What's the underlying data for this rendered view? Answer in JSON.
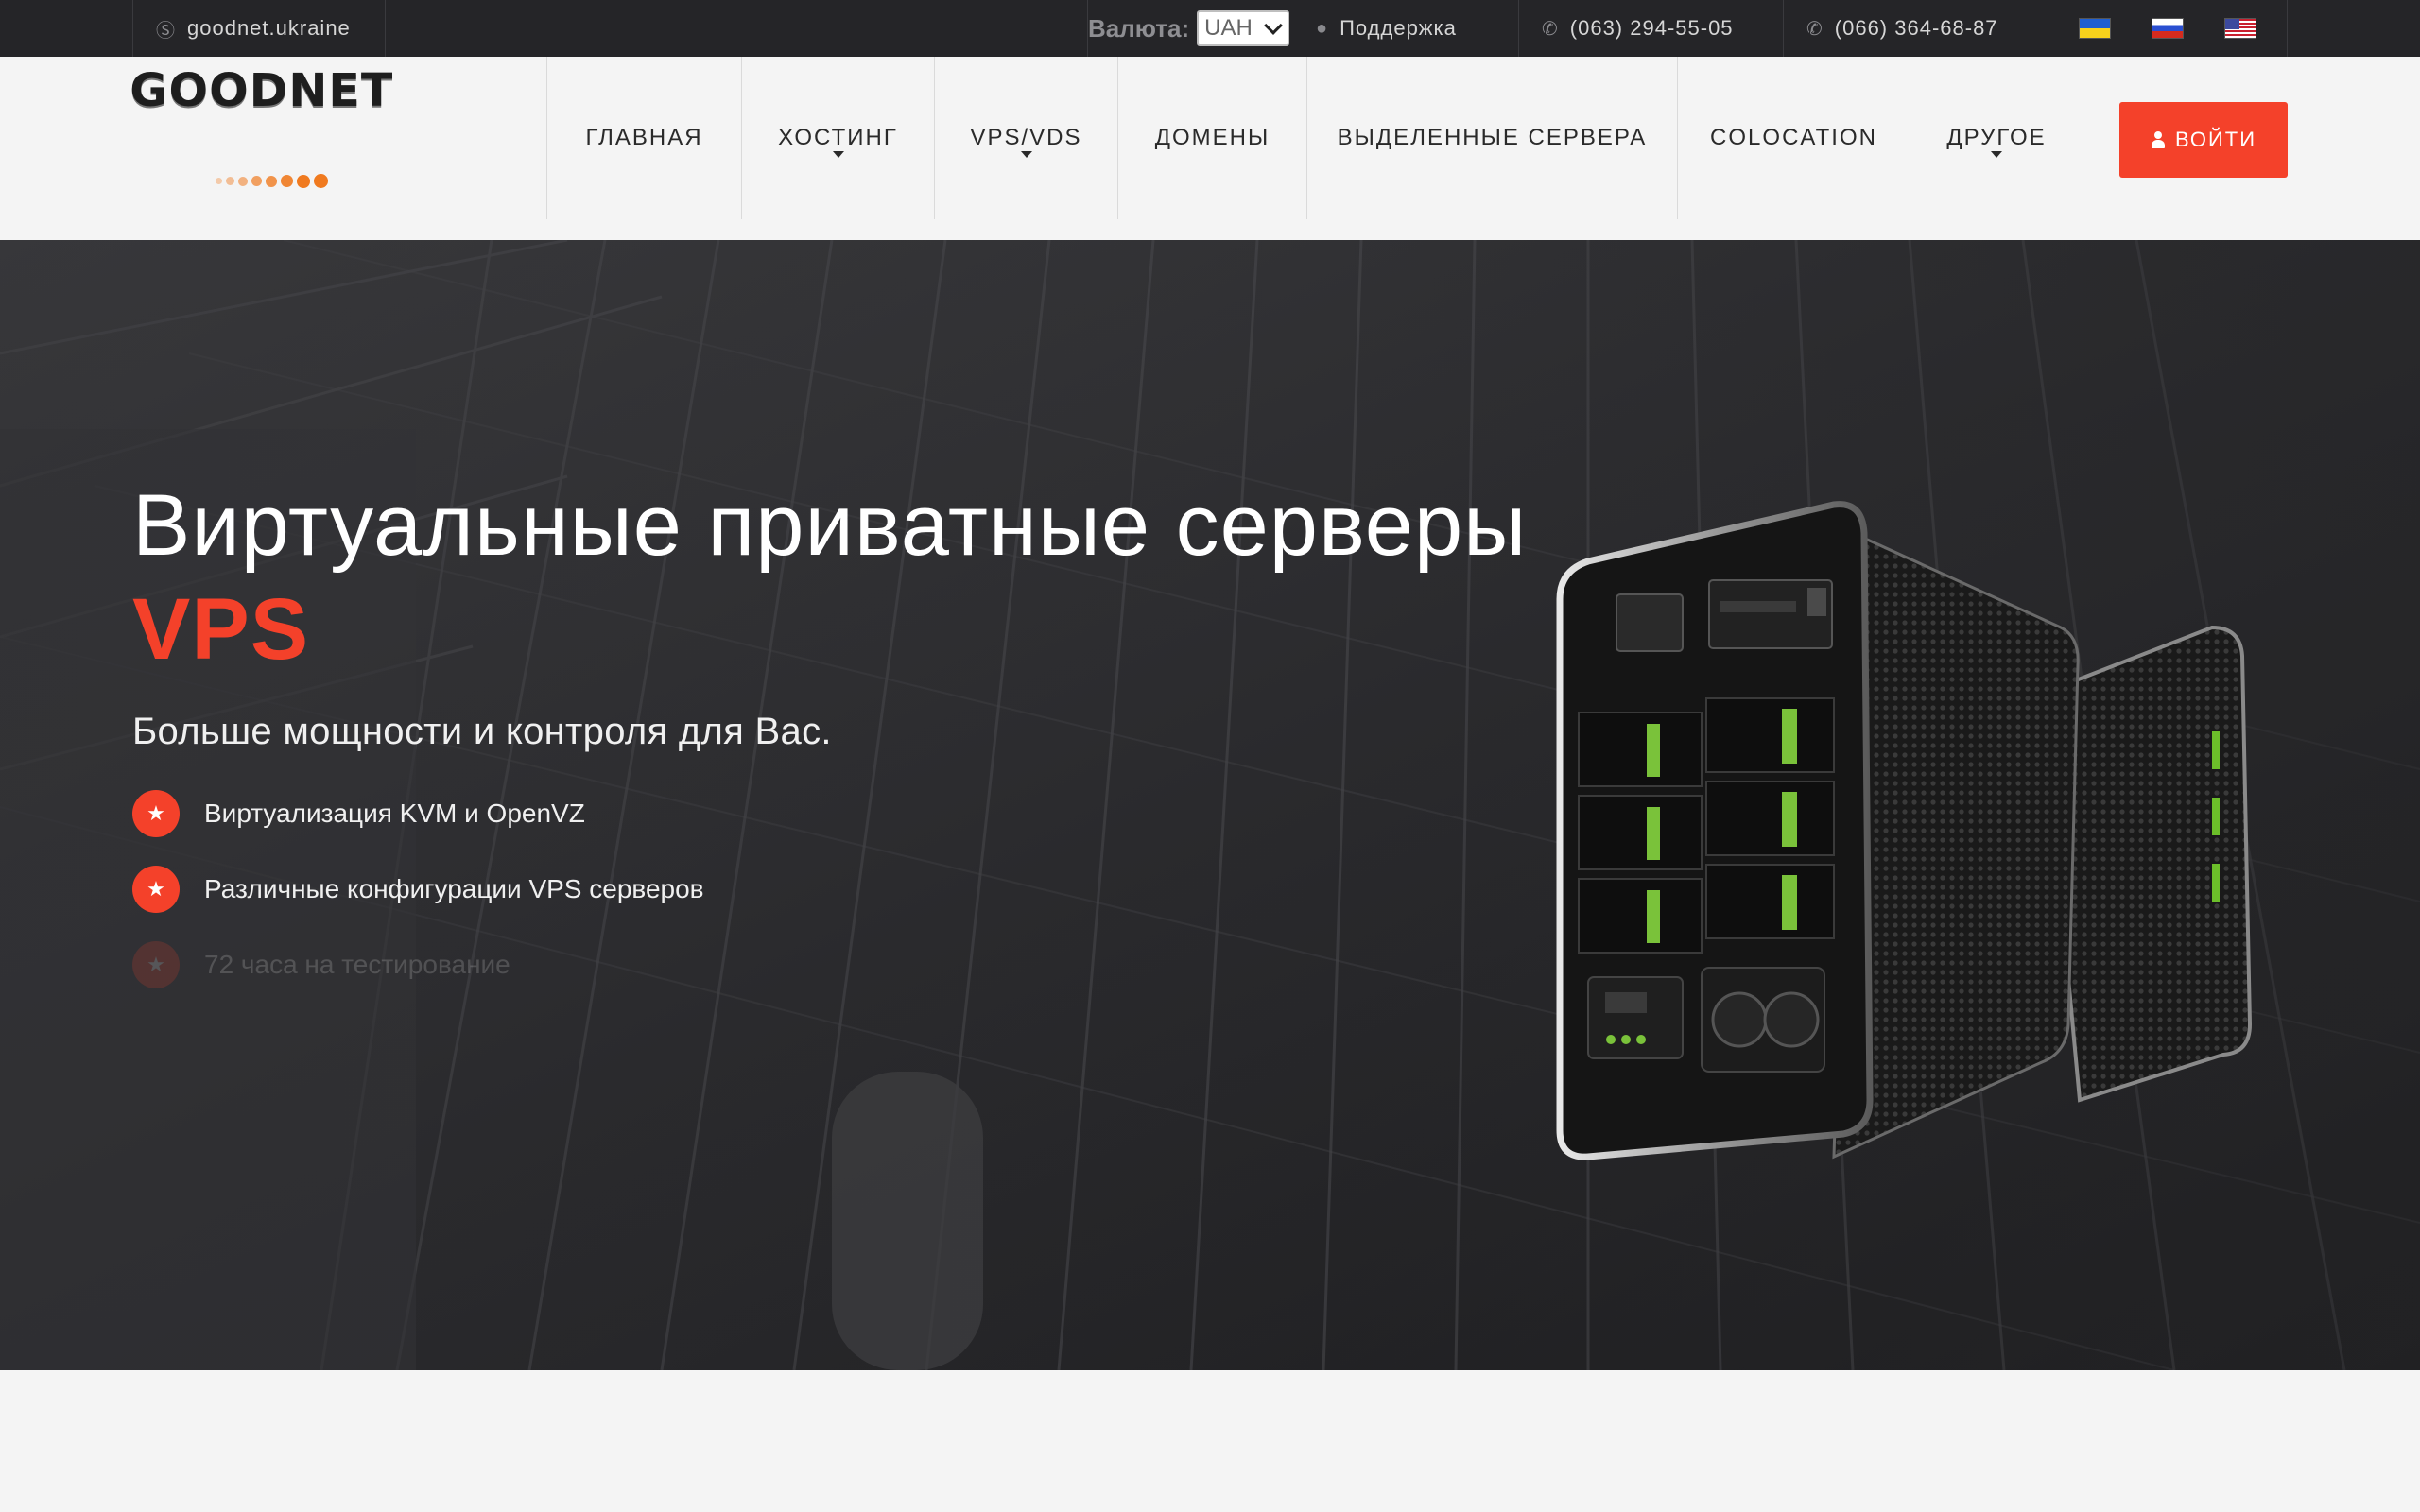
{
  "topbar": {
    "skype": "goodnet.ukraine",
    "currency_label": "Валюта:",
    "currency_value": "UAH",
    "support": "Поддержка",
    "phone1": "(063) 294-55-05",
    "phone2": "(066) 364-68-87",
    "flags": [
      "ukraine-flag",
      "russia-flag",
      "usa-flag"
    ]
  },
  "logo": {
    "text": "GOODNET"
  },
  "nav": {
    "items": [
      {
        "label": "ГЛАВНАЯ"
      },
      {
        "label": "ХОСТИНГ"
      },
      {
        "label": "VPS/VDS"
      },
      {
        "label": "ДОМЕНЫ"
      },
      {
        "label": "ВЫДЕЛЕННЫЕ СЕРВЕРА"
      },
      {
        "label": "COLOCATION"
      },
      {
        "label": "ДРУГОЕ"
      }
    ],
    "login": "ВОЙТИ"
  },
  "hero": {
    "title": "Виртуальные приватные серверы",
    "highlight": "VPS",
    "subtitle": "Больше мощности и контроля для Вас.",
    "features": [
      "Виртуализация KVM и OpenVZ",
      "Различные конфигурации VPS серверов",
      "72 часа на тестирование"
    ]
  },
  "colors": {
    "accent": "#f4412a",
    "topbar": "#252528",
    "header": "#f4f4f4",
    "hero": "#2b2b2e"
  }
}
